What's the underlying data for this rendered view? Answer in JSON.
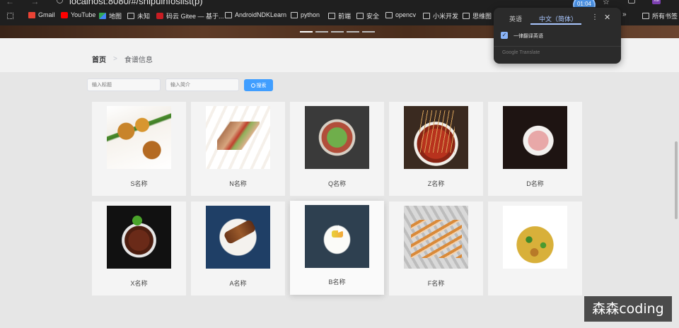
{
  "browser": {
    "url": "localhost:8080/#/shipuinfoslist(p)",
    "bookmarks": [
      {
        "label": "Gmail",
        "icon": "gmail-icon"
      },
      {
        "label": "YouTube",
        "icon": "youtube-icon"
      },
      {
        "label": "地图",
        "icon": "maps-icon"
      },
      {
        "label": "未知",
        "icon": "folder-icon"
      },
      {
        "label": "码云 Gitee — 基于...",
        "icon": "gitee-icon"
      },
      {
        "label": "AndroidNDKLearn",
        "icon": "folder-icon"
      },
      {
        "label": "python",
        "icon": "folder-icon"
      },
      {
        "label": "前端",
        "icon": "folder-icon"
      },
      {
        "label": "安全",
        "icon": "folder-icon"
      },
      {
        "label": "opencv",
        "icon": "folder-icon"
      },
      {
        "label": "小米开发",
        "icon": "folder-icon"
      },
      {
        "label": "思维图",
        "icon": "folder-icon"
      },
      {
        "label": "所有书签",
        "icon": "folder-icon"
      }
    ],
    "timer": "01:04",
    "profile_label": "XM"
  },
  "translate_popup": {
    "tab_source": "英语",
    "tab_target": "中文（简体）",
    "always_translate_label": "一律翻译英语",
    "always_translate_checked": true,
    "footer": "Google Translate",
    "more": "⋮",
    "close": "✕"
  },
  "breadcrumb": {
    "home": "首页",
    "separator": ">",
    "current": "食谱信息"
  },
  "search": {
    "title_placeholder": "输入标题",
    "intro_placeholder": "输入简介",
    "button_label": "搜索"
  },
  "recipes": [
    {
      "name": "S名称",
      "image": "skewers-with-green-vegetables"
    },
    {
      "name": "N名称",
      "image": "grilled-skewers"
    },
    {
      "name": "Q名称",
      "image": "salad-bowl"
    },
    {
      "name": "Z名称",
      "image": "chili-hotpot-skewers"
    },
    {
      "name": "D名称",
      "image": "sashimi-platter"
    },
    {
      "name": "X名称",
      "image": "braised-meat"
    },
    {
      "name": "A名称",
      "image": "kebab-plate"
    },
    {
      "name": "B名称",
      "image": "tofu-dish"
    },
    {
      "name": "F名称",
      "image": "shrimp-skewers"
    },
    {
      "name": "",
      "image": "kung-pao-chicken"
    }
  ],
  "watermark": "森森coding",
  "colors": {
    "primary": "#409eff",
    "page_bg": "#e6e6e6",
    "card_bg": "#f4f4f4",
    "chrome_bg": "#1f1f1f",
    "popup_bg": "#2b2b2b",
    "accent_blue": "#8ab4f8"
  }
}
